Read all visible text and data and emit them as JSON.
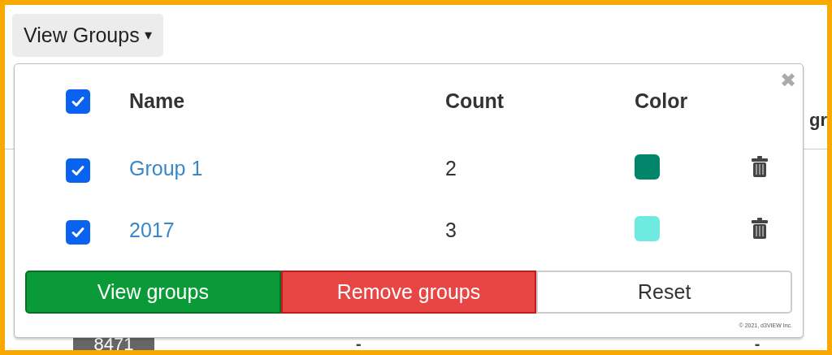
{
  "dropdown_button": {
    "label": "View Groups",
    "caret": "▾"
  },
  "background_table": {
    "header_fragment": "gr",
    "row_badge": "8471",
    "row_cells": [
      "-",
      "-"
    ]
  },
  "groups_panel": {
    "close": "✖",
    "select_all": {
      "checked": true
    },
    "columns": [
      "Name",
      "Count",
      "Color"
    ],
    "rows": [
      {
        "name": "Group 1",
        "count": "2",
        "color": "#00856a",
        "checked": true
      },
      {
        "name": "2017",
        "count": "3",
        "color": "#6eeae0",
        "checked": true
      }
    ],
    "buttons": [
      {
        "label": "View groups",
        "kind": "success"
      },
      {
        "label": "Remove groups",
        "kind": "danger"
      },
      {
        "label": "Reset",
        "kind": "default"
      }
    ],
    "copyright": "© 2021, d3VIEW Inc."
  }
}
